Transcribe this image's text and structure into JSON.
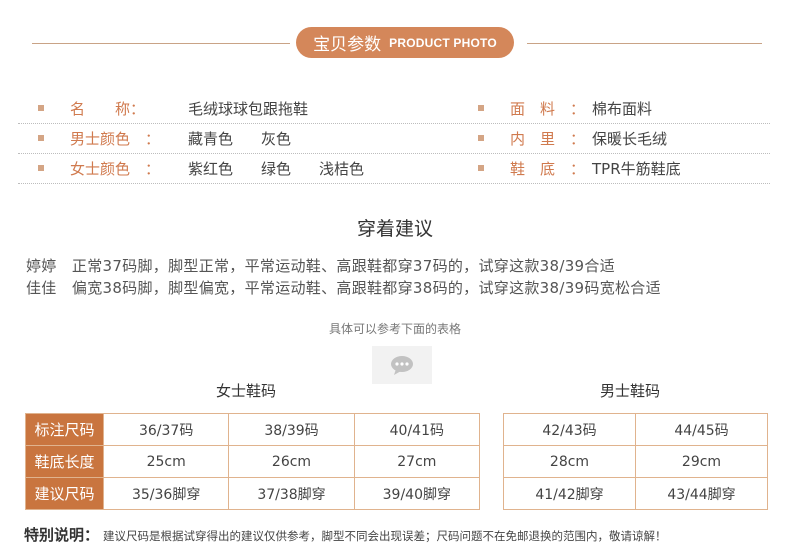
{
  "header": {
    "title_zh": "宝贝参数",
    "title_en": "PRODUCT PHOTO"
  },
  "params": [
    {
      "label": "名　　称：",
      "values": [
        "毛绒球球包跟拖鞋"
      ]
    },
    {
      "label": "面　料　：",
      "values": [
        "棉布面料"
      ]
    },
    {
      "label": "男士颜色　：",
      "values": [
        "藏青色",
        "灰色"
      ]
    },
    {
      "label": "内　里　：",
      "values": [
        "保暖长毛绒"
      ]
    },
    {
      "label": "女士颜色　：",
      "values": [
        "紫红色",
        "绿色",
        "浅桔色"
      ]
    },
    {
      "label": "鞋　底　：",
      "values": [
        "TPR牛筋鞋底"
      ]
    }
  ],
  "advice": {
    "title": "穿着建议",
    "lines": [
      "婷婷　正常37码脚，脚型正常，平常运动鞋、高跟鞋都穿37码的，试穿这款38/39合适",
      "佳佳　偏宽38码脚，脚型偏宽，平常运动鞋、高跟鞋都穿38码的，试穿这款38/39码宽松合适"
    ]
  },
  "refer_text": "具体可以参考下面的表格",
  "chat_icon": "chat-bubble-icon",
  "women": {
    "title": "女士鞋码",
    "rows": [
      {
        "head": "标注尺码",
        "cells": [
          "36/37码",
          "38/39码",
          "40/41码"
        ]
      },
      {
        "head": "鞋底长度",
        "cells": [
          "25cm",
          "26cm",
          "27cm"
        ]
      },
      {
        "head": "建议尺码",
        "cells": [
          "35/36脚穿",
          "37/38脚穿",
          "39/40脚穿"
        ]
      }
    ]
  },
  "men": {
    "title": "男士鞋码",
    "rows": [
      {
        "cells": [
          "42/43码",
          "44/45码"
        ]
      },
      {
        "cells": [
          "28cm",
          "29cm"
        ]
      },
      {
        "cells": [
          "41/42脚穿",
          "43/44脚穿"
        ]
      }
    ]
  },
  "note": {
    "title": "特别说明：",
    "body": "建议尺码是根据试穿得出的建议仅供参考，脚型不同会出现误差；尺码问题不在免邮退换的范围内，敬请谅解！"
  },
  "colors": {
    "accent": "#d4875a",
    "header_cell": "#c9753f",
    "label": "#d07a4e",
    "border": "#e0b38e"
  }
}
